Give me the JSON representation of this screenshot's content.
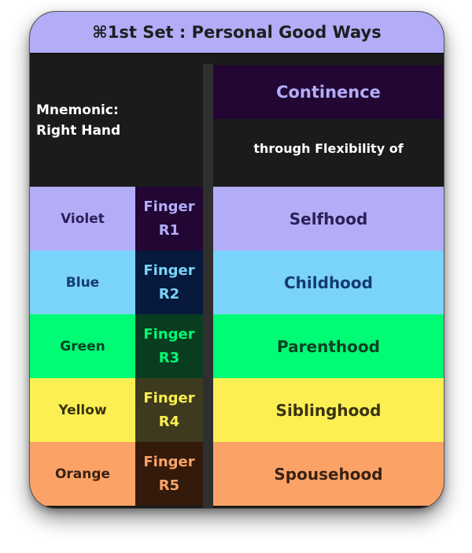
{
  "title": "⌘1st Set : Personal Good Ways",
  "mnemonic": {
    "line1": "Mnemonic:",
    "line2": "Right Hand"
  },
  "header": {
    "continence": "Continence",
    "through": "through Flexibility of"
  },
  "rows": [
    {
      "color": "Violet",
      "finger_word": "Finger",
      "finger_id": "R1",
      "value": "Selfhood",
      "bg": "#b3adf8",
      "text": "#2b2056",
      "finger_bg": "#220633",
      "finger_text": "#b3adf8"
    },
    {
      "color": "Blue",
      "finger_word": "Finger",
      "finger_id": "R2",
      "value": "Childhood",
      "bg": "#7ad3fb",
      "text": "#143c6e",
      "finger_bg": "#07193d",
      "finger_text": "#7ad3fb"
    },
    {
      "color": "Green",
      "finger_word": "Finger",
      "finger_id": "R3",
      "value": "Parenthood",
      "bg": "#00fb74",
      "text": "#0b4223",
      "finger_bg": "#083d20",
      "finger_text": "#00fb74"
    },
    {
      "color": "Yellow",
      "finger_word": "Finger",
      "finger_id": "R4",
      "value": "Siblinghood",
      "bg": "#fbef53",
      "text": "#3a3312",
      "finger_bg": "#3d3a1d",
      "finger_text": "#fbef53"
    },
    {
      "color": "Orange",
      "finger_word": "Finger",
      "finger_id": "R5",
      "value": "Spousehood",
      "bg": "#fba367",
      "text": "#3a2212",
      "finger_bg": "#331a0b",
      "finger_text": "#fba367"
    }
  ]
}
